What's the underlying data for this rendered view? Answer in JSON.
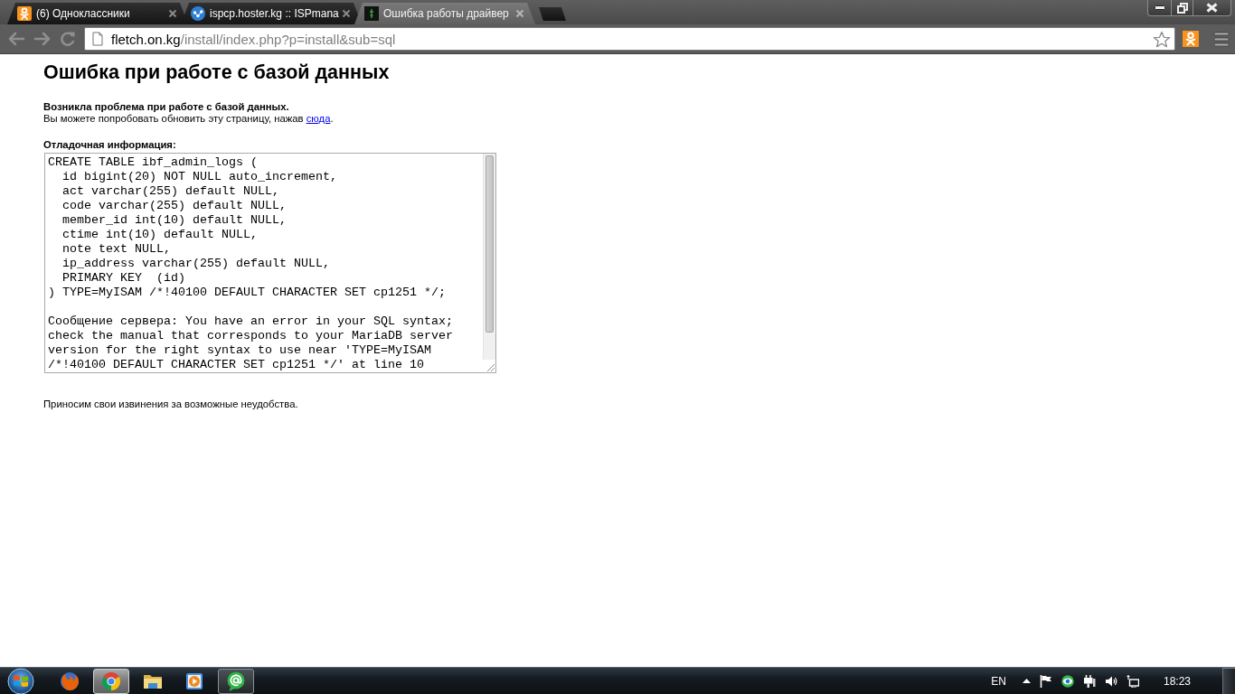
{
  "browser": {
    "tabs": [
      {
        "title": "(6) Одноклассники",
        "kind": "figure",
        "selected": false
      },
      {
        "title": "ispcp.hoster.kg :: ISPmana",
        "kind": "dots",
        "selected": false
      },
      {
        "title": "Ошибка работы драйвер",
        "kind": "tile",
        "selected": true
      }
    ],
    "address": {
      "host": "fletch.on.kg",
      "path": "/install/index.php?p=install&sub=sql"
    }
  },
  "page": {
    "heading": "Ошибка при работе с базой данных",
    "notice": "Возникла проблема при работе с базой данных.",
    "hint": {
      "text": "Вы можете попробовать обновить эту страницу, нажав ",
      "link": "сюда",
      "tail": "."
    },
    "debug_label": "Отладочная информация:",
    "debug_output": "CREATE TABLE ibf_admin_logs (\n  id bigint(20) NOT NULL auto_increment,\n  act varchar(255) default NULL,\n  code varchar(255) default NULL,\n  member_id int(10) default NULL,\n  ctime int(10) default NULL,\n  note text NULL,\n  ip_address varchar(255) default NULL,\n  PRIMARY KEY  (id)\n) TYPE=MyISAM /*!40100 DEFAULT CHARACTER SET cp1251 */;\n\nСообщение сервера: You have an error in your SQL syntax; check the manual that corresponds to your MariaDB server version for the right syntax to use near 'TYPE=MyISAM /*!40100 DEFAULT CHARACTER SET cp1251 */' at line 10",
    "apology": "Приносим свои извинения за возможные неудобства."
  },
  "taskbar": {
    "apps": [
      {
        "kind": "flame",
        "running": false,
        "selected": false
      },
      {
        "kind": "wheel",
        "running": true,
        "selected": true
      },
      {
        "kind": "folder",
        "running": false,
        "selected": false
      },
      {
        "kind": "player",
        "running": false,
        "selected": false
      },
      {
        "kind": "at",
        "running": true,
        "selected": false
      }
    ],
    "language": "EN",
    "clock": "18:23"
  }
}
